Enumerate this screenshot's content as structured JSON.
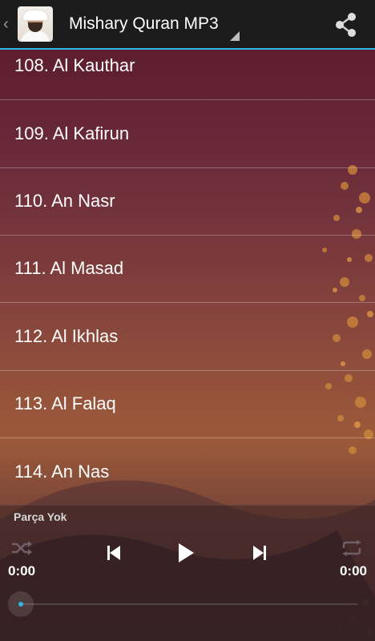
{
  "actionbar": {
    "title": "Mishary Quran MP3",
    "icons": {
      "up": "chevron-left-icon",
      "share": "share-icon"
    }
  },
  "list": {
    "items": [
      {
        "label": "108. Al Kauthar"
      },
      {
        "label": "109. Al Kafirun"
      },
      {
        "label": "110. An Nasr"
      },
      {
        "label": "111. Al Masad"
      },
      {
        "label": "112. Al Ikhlas"
      },
      {
        "label": "113. Al Falaq"
      },
      {
        "label": "114. An Nas"
      }
    ]
  },
  "player": {
    "track_name": "Parça Yok",
    "elapsed": "0:00",
    "duration": "0:00",
    "progress": 0,
    "icons": [
      "shuffle-icon",
      "previous-icon",
      "play-icon",
      "next-icon",
      "repeat-icon"
    ]
  },
  "colors": {
    "accent": "#33b5e5",
    "actionbar": "#1c1c1c"
  }
}
